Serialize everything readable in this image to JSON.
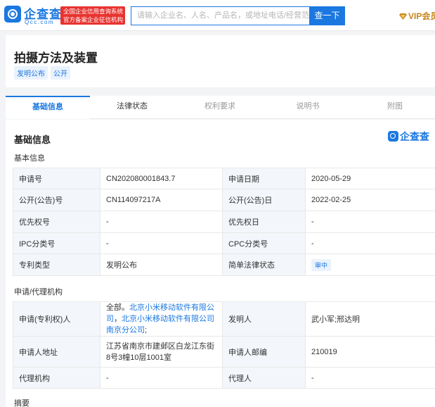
{
  "header": {
    "logo_text": "企查查",
    "logo_sub": "Qcc.com",
    "badge_line1": "全国企业信用查询系统",
    "badge_line2": "官方备案企业征信机构",
    "search_placeholder": "请输入企业名、人名、产品名，或地址电话/经营范围等",
    "search_button": "查一下",
    "vip_label": "VIP会员"
  },
  "patent": {
    "title": "拍摄方法及装置",
    "tags": [
      "发明公布",
      "公开"
    ]
  },
  "tabs": [
    {
      "label": "基础信息",
      "state": "active"
    },
    {
      "label": "法律状态",
      "state": "normal"
    },
    {
      "label": "权利要求",
      "state": "disabled"
    },
    {
      "label": "说明书",
      "state": "disabled"
    },
    {
      "label": "附图",
      "state": "disabled"
    }
  ],
  "section": {
    "title": "基础信息",
    "watermark": "企查查",
    "basic_subtitle": "基本信息",
    "agent_subtitle": "申请/代理机构",
    "abstract_title": "摘要"
  },
  "basic_rows": [
    {
      "l1": "申请号",
      "v1": "CN202080001843.7",
      "l2": "申请日期",
      "v2": "2020-05-29"
    },
    {
      "l1": "公开(公告)号",
      "v1": "CN114097217A",
      "l2": "公开(公告)日",
      "v2": "2022-02-25"
    },
    {
      "l1": "优先权号",
      "v1": "-",
      "l2": "优先权日",
      "v2": "-"
    },
    {
      "l1": "IPC分类号",
      "v1": "-",
      "l2": "CPC分类号",
      "v2": "-"
    },
    {
      "l1": "专利类型",
      "v1": "发明公布",
      "l2": "简单法律状态",
      "v2": "审中"
    }
  ],
  "agent": {
    "applicant_label": "申请(专利权)人",
    "applicant_prefix": "全部。",
    "applicant_link1": "北京小米移动软件有限公司",
    "applicant_sep": "，",
    "applicant_link2": "北京小米移动软件有限公司南京分公司",
    "applicant_suffix": ";",
    "inventor_label": "发明人",
    "inventor_value": "武小军;邢达明",
    "address_label": "申请人地址",
    "address_value": "江苏省南京市建邺区白龙江东街8号3幢10层1001室",
    "postcode_label": "申请人邮编",
    "postcode_value": "210019",
    "agency_label": "代理机构",
    "agency_value": "-",
    "agent_label": "代理人",
    "agent_value": "-"
  },
  "colors": {
    "brand_blue": "#1b78e0",
    "badge_red": "#e8332f",
    "vip_gold": "#c9851b"
  }
}
